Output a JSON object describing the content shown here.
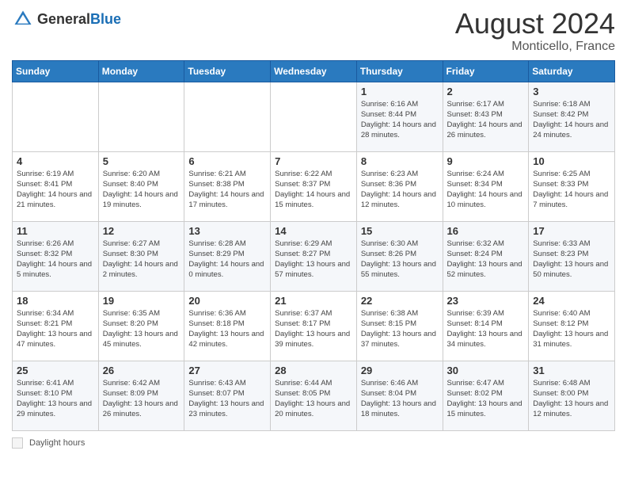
{
  "header": {
    "logo_general": "General",
    "logo_blue": "Blue",
    "title": "August 2024",
    "location": "Monticello, France"
  },
  "days_of_week": [
    "Sunday",
    "Monday",
    "Tuesday",
    "Wednesday",
    "Thursday",
    "Friday",
    "Saturday"
  ],
  "weeks": [
    [
      {
        "day": "",
        "info": ""
      },
      {
        "day": "",
        "info": ""
      },
      {
        "day": "",
        "info": ""
      },
      {
        "day": "",
        "info": ""
      },
      {
        "day": "1",
        "info": "Sunrise: 6:16 AM\nSunset: 8:44 PM\nDaylight: 14 hours and 28 minutes."
      },
      {
        "day": "2",
        "info": "Sunrise: 6:17 AM\nSunset: 8:43 PM\nDaylight: 14 hours and 26 minutes."
      },
      {
        "day": "3",
        "info": "Sunrise: 6:18 AM\nSunset: 8:42 PM\nDaylight: 14 hours and 24 minutes."
      }
    ],
    [
      {
        "day": "4",
        "info": "Sunrise: 6:19 AM\nSunset: 8:41 PM\nDaylight: 14 hours and 21 minutes."
      },
      {
        "day": "5",
        "info": "Sunrise: 6:20 AM\nSunset: 8:40 PM\nDaylight: 14 hours and 19 minutes."
      },
      {
        "day": "6",
        "info": "Sunrise: 6:21 AM\nSunset: 8:38 PM\nDaylight: 14 hours and 17 minutes."
      },
      {
        "day": "7",
        "info": "Sunrise: 6:22 AM\nSunset: 8:37 PM\nDaylight: 14 hours and 15 minutes."
      },
      {
        "day": "8",
        "info": "Sunrise: 6:23 AM\nSunset: 8:36 PM\nDaylight: 14 hours and 12 minutes."
      },
      {
        "day": "9",
        "info": "Sunrise: 6:24 AM\nSunset: 8:34 PM\nDaylight: 14 hours and 10 minutes."
      },
      {
        "day": "10",
        "info": "Sunrise: 6:25 AM\nSunset: 8:33 PM\nDaylight: 14 hours and 7 minutes."
      }
    ],
    [
      {
        "day": "11",
        "info": "Sunrise: 6:26 AM\nSunset: 8:32 PM\nDaylight: 14 hours and 5 minutes."
      },
      {
        "day": "12",
        "info": "Sunrise: 6:27 AM\nSunset: 8:30 PM\nDaylight: 14 hours and 2 minutes."
      },
      {
        "day": "13",
        "info": "Sunrise: 6:28 AM\nSunset: 8:29 PM\nDaylight: 14 hours and 0 minutes."
      },
      {
        "day": "14",
        "info": "Sunrise: 6:29 AM\nSunset: 8:27 PM\nDaylight: 13 hours and 57 minutes."
      },
      {
        "day": "15",
        "info": "Sunrise: 6:30 AM\nSunset: 8:26 PM\nDaylight: 13 hours and 55 minutes."
      },
      {
        "day": "16",
        "info": "Sunrise: 6:32 AM\nSunset: 8:24 PM\nDaylight: 13 hours and 52 minutes."
      },
      {
        "day": "17",
        "info": "Sunrise: 6:33 AM\nSunset: 8:23 PM\nDaylight: 13 hours and 50 minutes."
      }
    ],
    [
      {
        "day": "18",
        "info": "Sunrise: 6:34 AM\nSunset: 8:21 PM\nDaylight: 13 hours and 47 minutes."
      },
      {
        "day": "19",
        "info": "Sunrise: 6:35 AM\nSunset: 8:20 PM\nDaylight: 13 hours and 45 minutes."
      },
      {
        "day": "20",
        "info": "Sunrise: 6:36 AM\nSunset: 8:18 PM\nDaylight: 13 hours and 42 minutes."
      },
      {
        "day": "21",
        "info": "Sunrise: 6:37 AM\nSunset: 8:17 PM\nDaylight: 13 hours and 39 minutes."
      },
      {
        "day": "22",
        "info": "Sunrise: 6:38 AM\nSunset: 8:15 PM\nDaylight: 13 hours and 37 minutes."
      },
      {
        "day": "23",
        "info": "Sunrise: 6:39 AM\nSunset: 8:14 PM\nDaylight: 13 hours and 34 minutes."
      },
      {
        "day": "24",
        "info": "Sunrise: 6:40 AM\nSunset: 8:12 PM\nDaylight: 13 hours and 31 minutes."
      }
    ],
    [
      {
        "day": "25",
        "info": "Sunrise: 6:41 AM\nSunset: 8:10 PM\nDaylight: 13 hours and 29 minutes."
      },
      {
        "day": "26",
        "info": "Sunrise: 6:42 AM\nSunset: 8:09 PM\nDaylight: 13 hours and 26 minutes."
      },
      {
        "day": "27",
        "info": "Sunrise: 6:43 AM\nSunset: 8:07 PM\nDaylight: 13 hours and 23 minutes."
      },
      {
        "day": "28",
        "info": "Sunrise: 6:44 AM\nSunset: 8:05 PM\nDaylight: 13 hours and 20 minutes."
      },
      {
        "day": "29",
        "info": "Sunrise: 6:46 AM\nSunset: 8:04 PM\nDaylight: 13 hours and 18 minutes."
      },
      {
        "day": "30",
        "info": "Sunrise: 6:47 AM\nSunset: 8:02 PM\nDaylight: 13 hours and 15 minutes."
      },
      {
        "day": "31",
        "info": "Sunrise: 6:48 AM\nSunset: 8:00 PM\nDaylight: 13 hours and 12 minutes."
      }
    ]
  ],
  "footer": {
    "legend_label": "Daylight hours"
  }
}
